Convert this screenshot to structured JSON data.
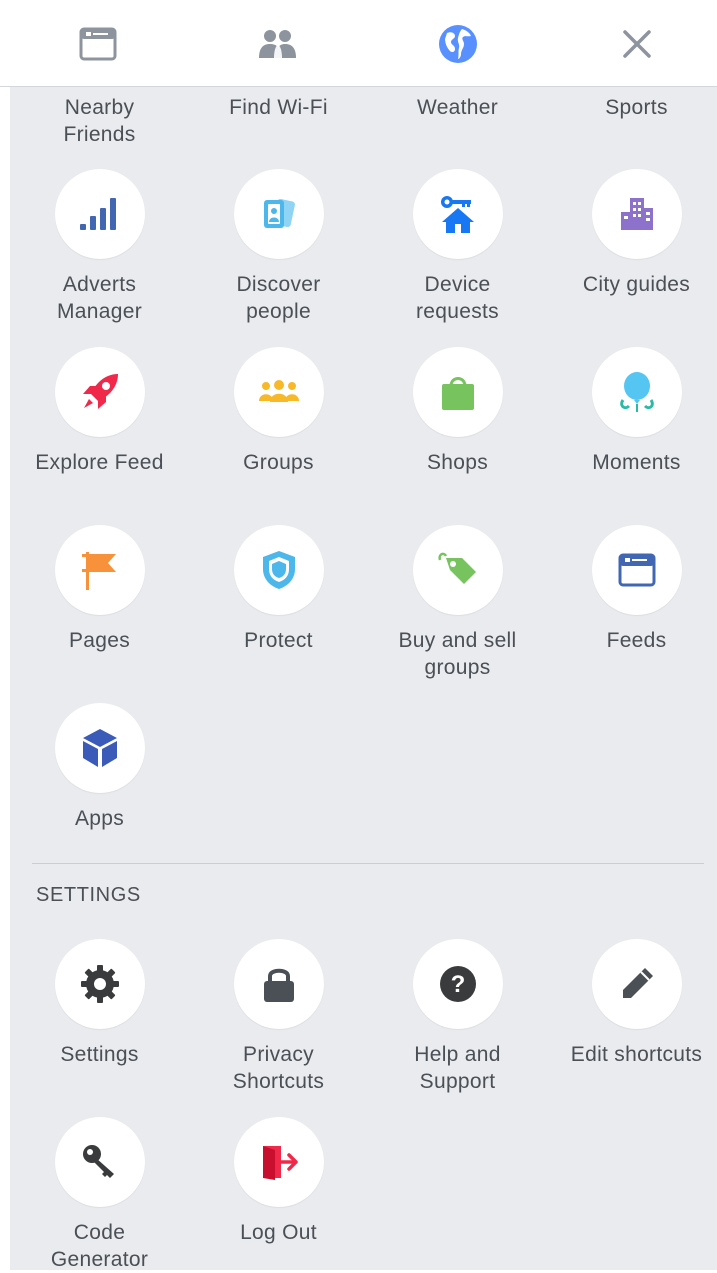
{
  "top_bar": {
    "icons": [
      "feed-icon",
      "friends-icon",
      "globe-icon",
      "close-icon"
    ]
  },
  "shortcuts_partial": [
    "Nearby\nFriends",
    "Find Wi-Fi",
    "Weather",
    "Sports"
  ],
  "shortcuts": [
    {
      "label": "Adverts Manager",
      "icon": "bar-chart-icon"
    },
    {
      "label": "Discover people",
      "icon": "contact-cards-icon"
    },
    {
      "label": "Device requests",
      "icon": "house-key-icon"
    },
    {
      "label": "City guides",
      "icon": "city-buildings-icon"
    },
    {
      "label": "Explore Feed",
      "icon": "rocket-icon"
    },
    {
      "label": "Groups",
      "icon": "group-people-icon"
    },
    {
      "label": "Shops",
      "icon": "shopping-bag-icon"
    },
    {
      "label": "Moments",
      "icon": "balloon-icon"
    },
    {
      "label": "Pages",
      "icon": "flag-icon"
    },
    {
      "label": "Protect",
      "icon": "shield-icon"
    },
    {
      "label": "Buy and sell groups",
      "icon": "price-tag-icon"
    },
    {
      "label": "Feeds",
      "icon": "feeds-icon"
    },
    {
      "label": "Apps",
      "icon": "cube-icon"
    }
  ],
  "settings": {
    "heading": "SETTINGS",
    "items": [
      {
        "label": "Settings",
        "icon": "gear-icon"
      },
      {
        "label": "Privacy Shortcuts",
        "icon": "lock-icon"
      },
      {
        "label": "Help and Support",
        "icon": "question-icon"
      },
      {
        "label": "Edit shortcuts",
        "icon": "pencil-icon"
      },
      {
        "label": "Code Generator",
        "icon": "key-icon"
      },
      {
        "label": "Log Out",
        "icon": "logout-icon"
      }
    ]
  },
  "colors": {
    "panel_bg": "#e9ebee",
    "label_text": "#4b4f56",
    "facebook_blue": "#4267b2",
    "globe_blue": "#5890ff"
  }
}
